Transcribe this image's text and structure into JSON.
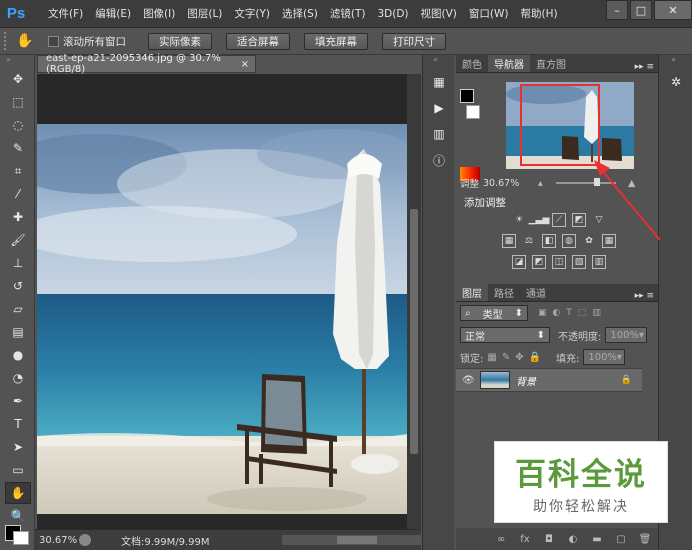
{
  "app": {
    "logo": "Ps"
  },
  "menu": [
    "文件(F)",
    "编辑(E)",
    "图像(I)",
    "图层(L)",
    "文字(Y)",
    "选择(S)",
    "滤镜(T)",
    "3D(D)",
    "视图(V)",
    "窗口(W)",
    "帮助(H)"
  ],
  "options": {
    "scroll_all_label": "滚动所有窗口",
    "buttons": [
      "实际像素",
      "适合屏幕",
      "填充屏幕",
      "打印尺寸"
    ]
  },
  "document": {
    "tab_title": "east-ep-a21-2095346.jpg @ 30.7%(RGB/8)",
    "zoom": "30.67%",
    "doc_size": "文档:9.99M/9.99M"
  },
  "navigator": {
    "tabs": [
      "颜色",
      "导航器",
      "直方图"
    ],
    "active_tab": "导航器",
    "zoom": "30.67%"
  },
  "adjustments": {
    "label": "调整",
    "title": "添加调整"
  },
  "layers_panel": {
    "tabs": [
      "图层",
      "路径",
      "通道"
    ],
    "filter_kind": "类型",
    "blend_mode": "正常",
    "opacity_label": "不透明度:",
    "opacity_value": "100%",
    "lock_label": "锁定:",
    "fill_label": "填充:",
    "fill_value": "100%",
    "layer_name": "背景"
  },
  "watermark": {
    "title": "百科全说",
    "subtitle": "助你轻松解决"
  },
  "colors": {
    "accent_red": "#e83030",
    "ps_blue": "#3fa4ff",
    "watermark_green": "#5a9a3a"
  }
}
